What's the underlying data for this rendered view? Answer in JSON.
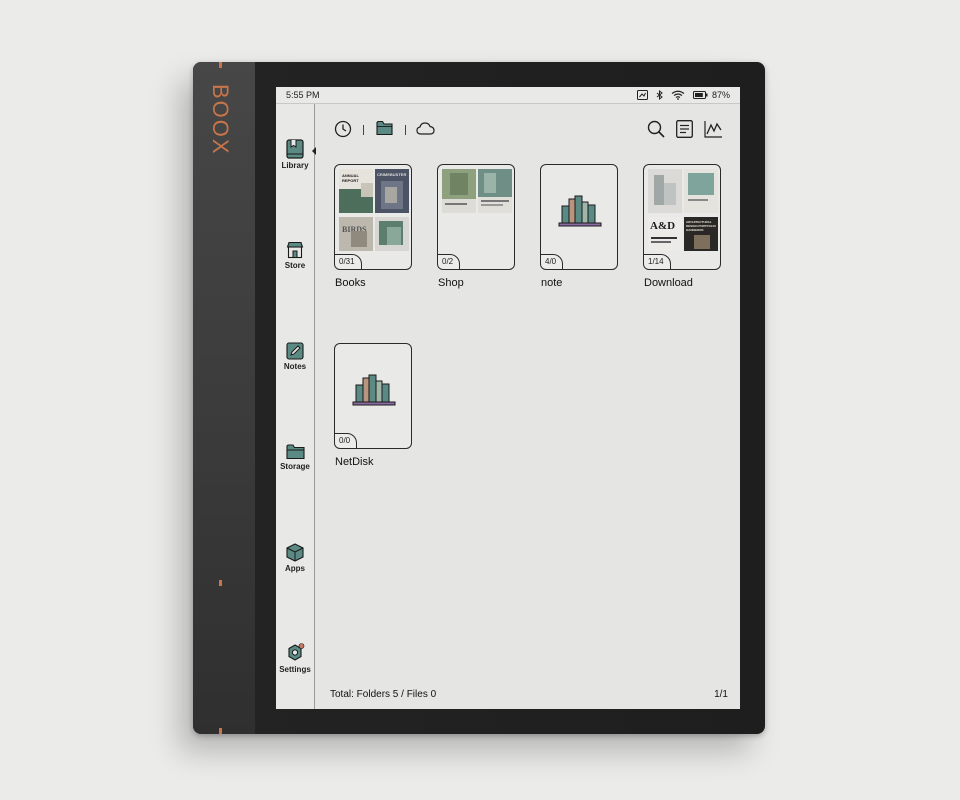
{
  "device": {
    "brand": "BOOX"
  },
  "status_bar": {
    "time": "5:55 PM",
    "battery": "87%",
    "battery_level": 0.87
  },
  "sidebar": {
    "items": [
      {
        "label": "Library",
        "icon": "library-icon",
        "active": true
      },
      {
        "label": "Store",
        "icon": "store-icon"
      },
      {
        "label": "Notes",
        "icon": "notes-icon"
      },
      {
        "label": "Storage",
        "icon": "storage-icon"
      },
      {
        "label": "Apps",
        "icon": "apps-icon"
      },
      {
        "label": "Settings",
        "icon": "settings-icon"
      }
    ]
  },
  "toolbar": {
    "left_icons": [
      "recent-clock-icon",
      "local-folder-icon",
      "cloud-icon"
    ],
    "right_icons": [
      "search-icon",
      "list-view-icon",
      "statistics-icon"
    ]
  },
  "folders": [
    {
      "name": "Books",
      "count": "0/31"
    },
    {
      "name": "Shop",
      "count": "0/2"
    },
    {
      "name": "note",
      "count": "4/0"
    },
    {
      "name": "Download",
      "count": "1/14"
    },
    {
      "name": "NetDisk",
      "count": "0/0"
    }
  ],
  "thumbnail_text": {
    "annual_report": "ANNUAL REPORT",
    "crimebuster": "CRIMEBUSTER",
    "birds": "BIRDS",
    "ad_title": "A&D",
    "architectural": "ARCHITECTURAL DESIGN PORTFOLIO HANDBOOK"
  },
  "footer": {
    "total": "Total: Folders 5 / Files 0",
    "page": "1/1"
  },
  "colors": {
    "accent": "#c8754a",
    "folder_teal": "#5b8a84",
    "screen_bg": "#e5e5e4"
  }
}
